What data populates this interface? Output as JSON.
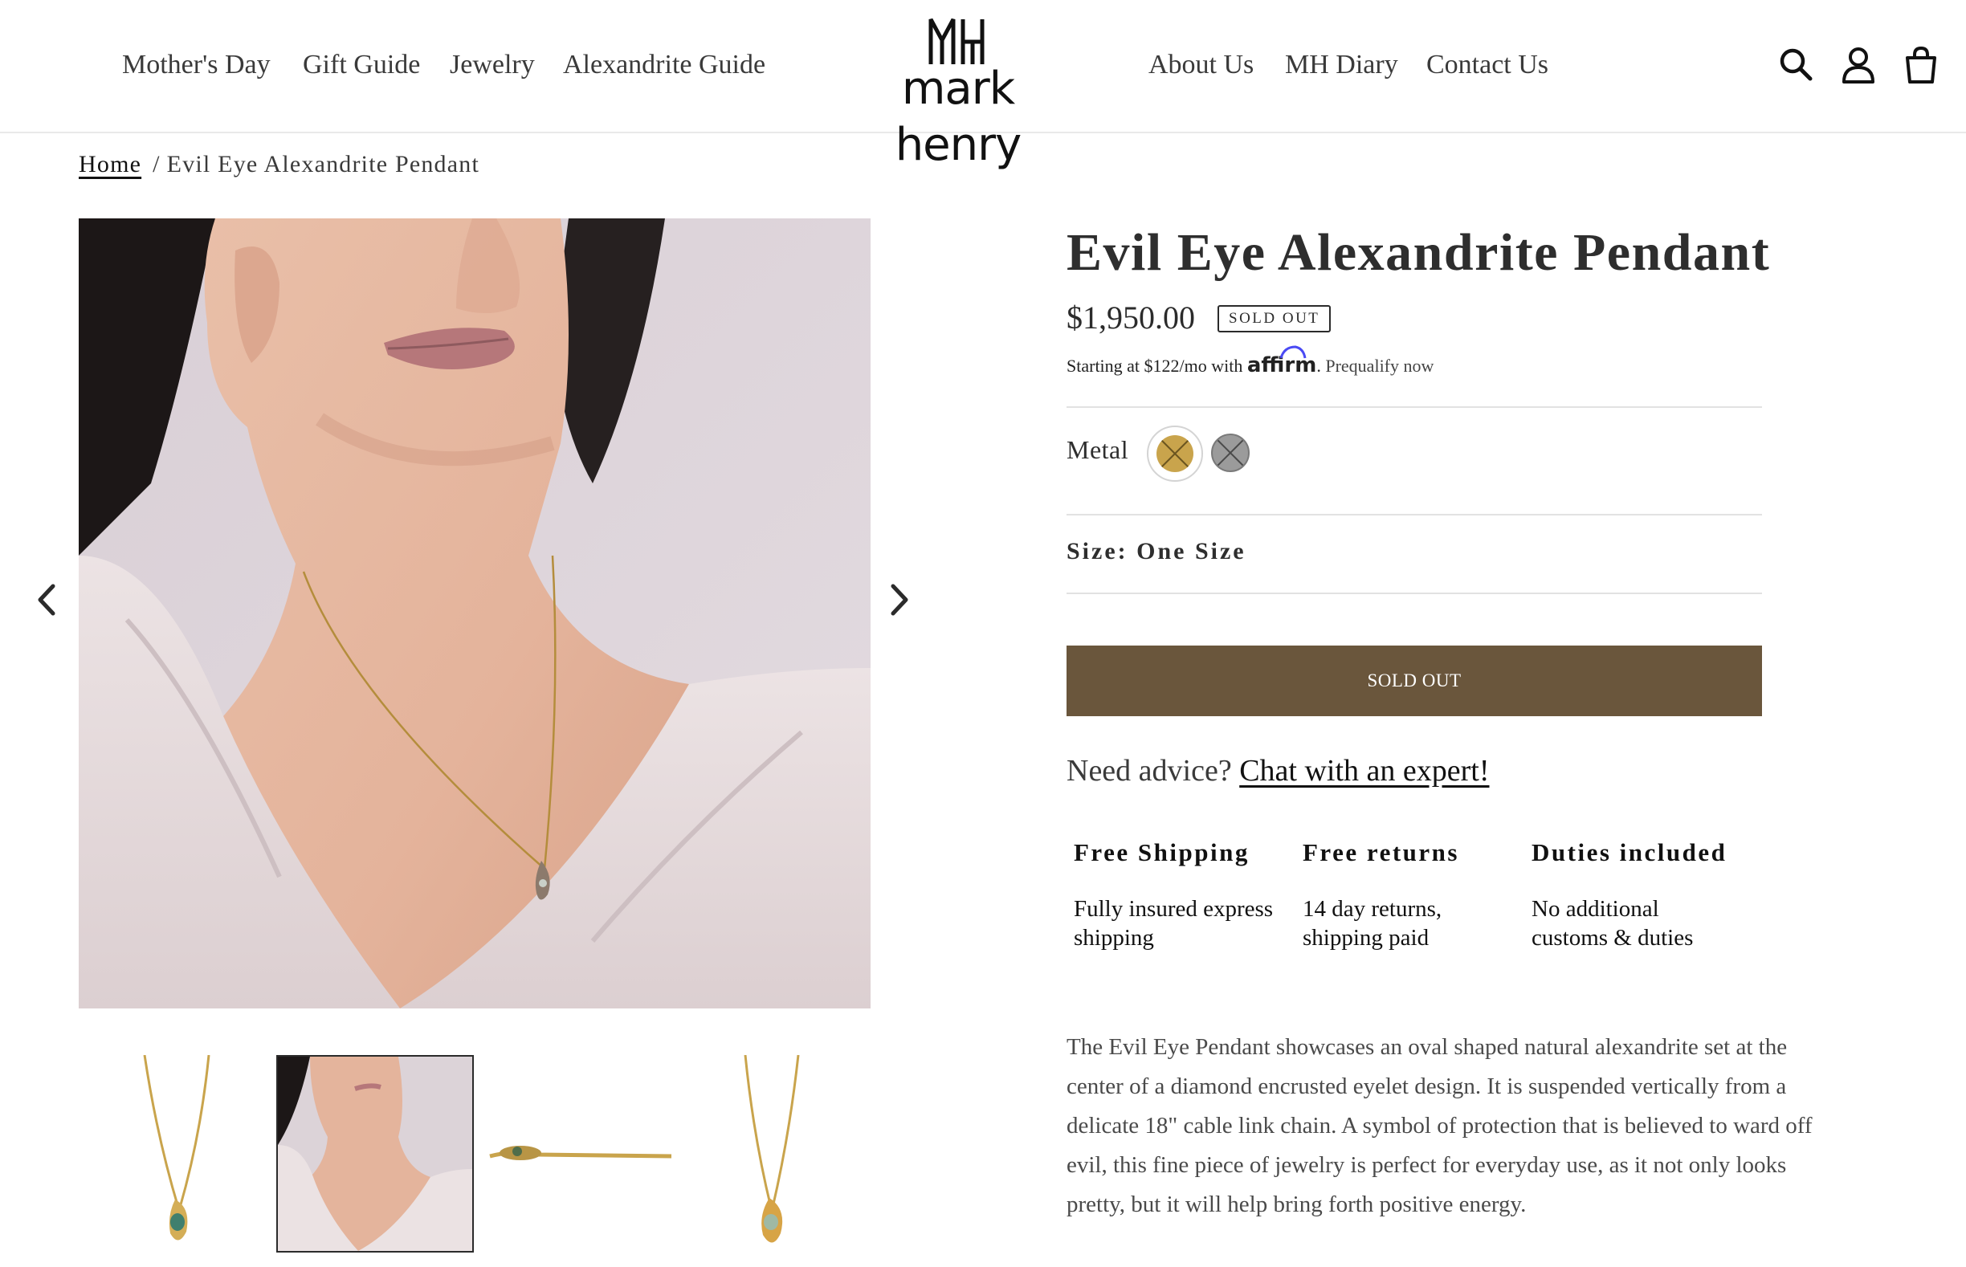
{
  "header": {
    "nav_left": [
      "Mother's Day",
      "Gift Guide",
      "Jewelry",
      "Alexandrite Guide"
    ],
    "nav_right": [
      "About Us",
      "MH Diary",
      "Contact Us"
    ],
    "logo_monogram": "MH",
    "logo_text": "mark henry",
    "icons": [
      "search-icon",
      "account-icon",
      "cart-icon"
    ]
  },
  "breadcrumb": {
    "home": "Home",
    "separator": "/",
    "current": "Evil Eye Alexandrite Pendant"
  },
  "gallery": {
    "icons": [
      "chevron-left-icon",
      "chevron-right-icon"
    ],
    "thumbnails_count": 4,
    "active_thumbnail": 2
  },
  "product": {
    "title": "Evil Eye Alexandrite Pendant",
    "price": "$1,950.00",
    "badge": "SOLD OUT",
    "affirm_prefix": "Starting at $122/mo with",
    "affirm_brand": "affirm",
    "affirm_suffix": ".",
    "affirm_link": "Prequalify now",
    "metal_label": "Metal",
    "metal_swatches": [
      {
        "name": "yellow gold",
        "color": "#c9a44c",
        "selected": true,
        "unavailable": true
      },
      {
        "name": "white gold",
        "color": "#9b9b9b",
        "selected": false,
        "unavailable": true
      }
    ],
    "size_label": "Size: One Size",
    "button_label": "SOLD OUT",
    "advice_text": "Need advice?",
    "advice_link": "Chat with an expert!",
    "features": [
      {
        "title": "Free Shipping",
        "text": "Fully insured express shipping"
      },
      {
        "title": "Free returns",
        "text": "14 day returns, shipping paid"
      },
      {
        "title": "Duties included",
        "text": "No additional customs & duties"
      }
    ],
    "description": "The Evil Eye Pendant showcases an oval shaped natural alexandrite set at the center of a diamond encrusted eyelet design. It is suspended vertically from a delicate 18\" cable link chain. A symbol of protection that is believed to ward off evil, this fine piece of jewelry is perfect for everyday use, as it not only looks pretty, but it will help bring forth positive energy."
  },
  "colors": {
    "button_bg": "#6a563c",
    "text": "#2b2b2b",
    "gold": "#c9a44c",
    "silver": "#9b9b9b"
  }
}
